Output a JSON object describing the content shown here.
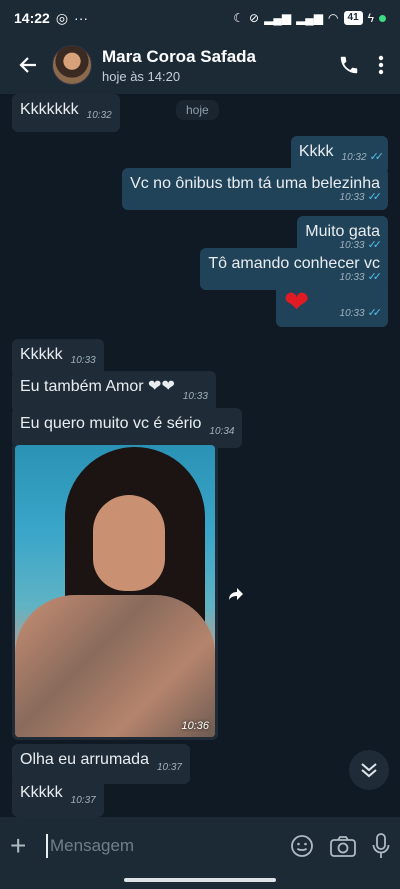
{
  "status": {
    "time": "14:22",
    "battery": "41"
  },
  "header": {
    "name": "Mara Coroa Safada",
    "last_seen": "hoje às 14:20"
  },
  "day_chip": "hoje",
  "messages": [
    {
      "text": "Kkkkkkk",
      "time": "10:32"
    },
    {
      "text": "Kkkk",
      "time": "10:32"
    },
    {
      "text": "Vc no ônibus tbm tá uma belezinha",
      "time": "10:33"
    },
    {
      "text": "Muito gata",
      "time": "10:33"
    },
    {
      "text": "Tô amando conhecer vc",
      "time": "10:33"
    },
    {
      "text": "❤",
      "time": "10:33"
    },
    {
      "text": "Kkkkk",
      "time": "10:33"
    },
    {
      "text": "Eu também Amor ❤❤",
      "time": "10:33"
    },
    {
      "text": "Eu quero muito vc é sério",
      "time": "10:34"
    },
    {
      "text": "",
      "time": "10:36"
    },
    {
      "text": "Olha eu arrumada",
      "time": "10:37"
    },
    {
      "text": "Kkkkk",
      "time": "10:37"
    }
  ],
  "composer": {
    "placeholder": "Mensagem"
  },
  "icons": {
    "back": "arrow-left-icon",
    "call": "phone-icon",
    "menu": "more-vert-icon",
    "forward": "forward-icon",
    "scroll": "chevron-double-down-icon",
    "attach": "plus-icon",
    "emoji": "emoji-icon",
    "camera": "camera-icon",
    "mic": "mic-icon"
  },
  "colors": {
    "bg": "#0f1a24",
    "incoming": "#1f2c38",
    "outgoing": "#21435a",
    "read_ticks": "#53bdeb"
  }
}
